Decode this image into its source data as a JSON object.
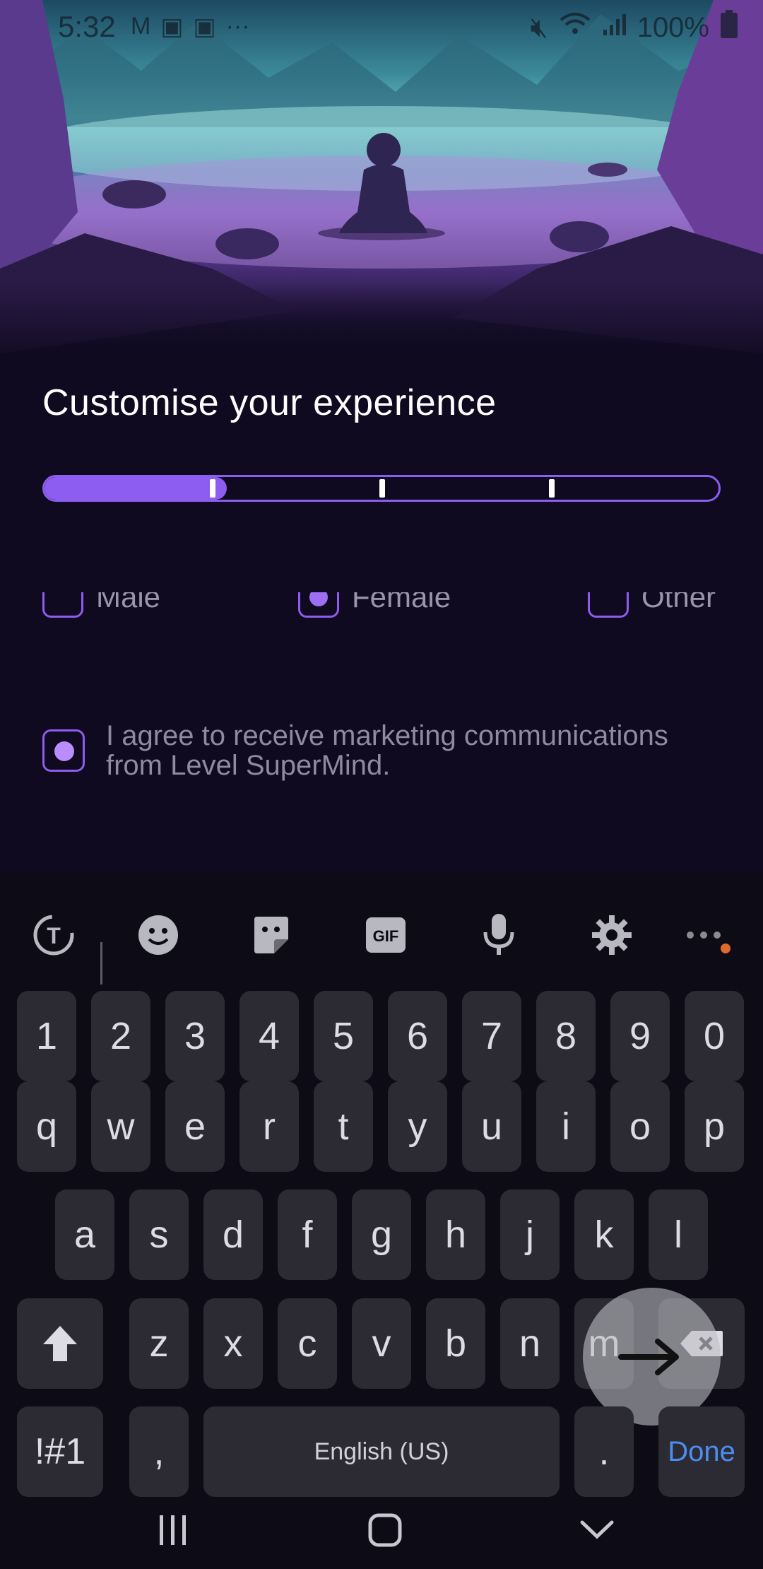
{
  "status_bar": {
    "time": "5:32",
    "battery": "100%"
  },
  "screen": {
    "title": "Customise your experience",
    "progress": {
      "fraction": 0.27,
      "segments": 4
    },
    "gender_options": [
      {
        "label": "Male",
        "checked": false
      },
      {
        "label": "Female",
        "checked": true
      },
      {
        "label": "Other",
        "checked": false
      }
    ],
    "consent": {
      "checked": true,
      "text": "I agree to receive marketing communications from Level SuperMind."
    }
  },
  "keyboard": {
    "toolbar": [
      "text-mode-icon",
      "emoji-icon",
      "sticker-icon",
      "gif-icon",
      "mic-icon",
      "gear-icon",
      "more-icon"
    ],
    "gif_label": "GIF",
    "row_numbers": [
      "1",
      "2",
      "3",
      "4",
      "5",
      "6",
      "7",
      "8",
      "9",
      "0"
    ],
    "row1": [
      "q",
      "w",
      "e",
      "r",
      "t",
      "y",
      "u",
      "i",
      "o",
      "p"
    ],
    "row2": [
      "a",
      "s",
      "d",
      "f",
      "g",
      "h",
      "j",
      "k",
      "l"
    ],
    "row3": [
      "z",
      "x",
      "c",
      "v",
      "b",
      "n",
      "m"
    ],
    "symbols_label": "!#1",
    "comma_label": ",",
    "space_label": "English (US)",
    "period_label": ".",
    "done_label": "Done"
  },
  "colors": {
    "accent": "#8d5cf0",
    "background": "#0f0a1f",
    "keyboard_bg": "#0c0b16",
    "key_bg": "#2c2b33",
    "done_text": "#4b8ef0"
  }
}
